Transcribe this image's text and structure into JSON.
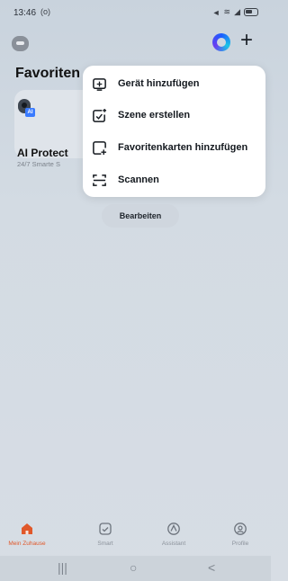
{
  "status_bar": {
    "time": "13:46",
    "time_extra": "(o)"
  },
  "header": {
    "favorites_title": "Favoriten"
  },
  "card": {
    "title": "AI Protect",
    "subtitle": "24/7 Smarte S",
    "badge": "AI"
  },
  "menu": {
    "items": [
      {
        "label": "Gerät hinzufügen",
        "icon": "add-device-icon"
      },
      {
        "label": "Szene erstellen",
        "icon": "create-scene-icon"
      },
      {
        "label": "Favoritenkarten hinzufügen",
        "icon": "add-favorite-card-icon"
      },
      {
        "label": "Scannen",
        "icon": "scan-icon"
      }
    ]
  },
  "edit_button": {
    "label": "Bearbeiten"
  },
  "bottom_nav": {
    "items": [
      {
        "label": "Mein Zuhause",
        "icon": "home-icon",
        "active": true
      },
      {
        "label": "Smart",
        "icon": "smart-icon",
        "active": false
      },
      {
        "label": "Assistant",
        "icon": "assistant-icon",
        "active": false
      },
      {
        "label": "Profile",
        "icon": "profile-icon",
        "active": false
      }
    ]
  },
  "colors": {
    "accent": "#e0582a",
    "background": "#d3dbe3",
    "menu_bg": "#ffffff"
  }
}
